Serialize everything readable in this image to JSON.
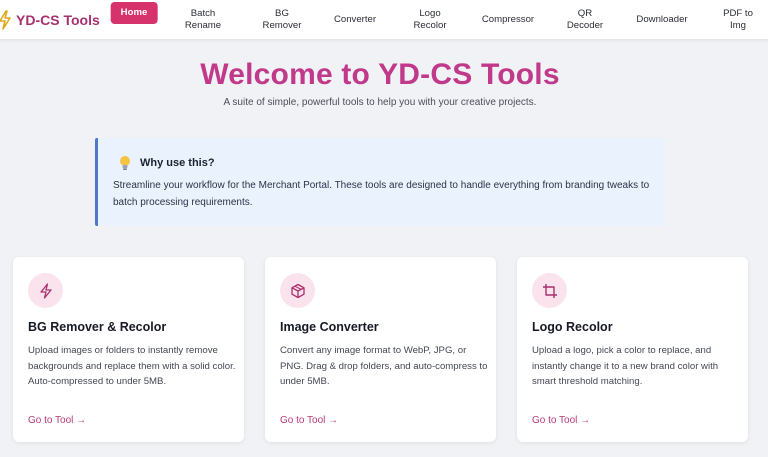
{
  "brand": {
    "name": "YD-CS Tools",
    "icon": "lightning-bolt-icon"
  },
  "nav": {
    "items": [
      {
        "label": "Home",
        "active": true
      },
      {
        "label": "Batch\nRename",
        "active": false
      },
      {
        "label": "BG\nRemover",
        "active": false
      },
      {
        "label": "Converter",
        "active": false
      },
      {
        "label": "Logo\nRecolor",
        "active": false
      },
      {
        "label": "Compressor",
        "active": false
      },
      {
        "label": "QR\nDecoder",
        "active": false
      },
      {
        "label": "Downloader",
        "active": false
      },
      {
        "label": "PDF to\nImg",
        "active": false
      }
    ]
  },
  "hero": {
    "title": "Welcome to YD-CS Tools",
    "subtitle": "A suite of simple, powerful tools to help you with your creative projects."
  },
  "info": {
    "icon": "lightbulb-icon",
    "title": "Why use this?",
    "text": "Streamline your workflow for the Merchant Portal. These tools are designed to handle everything from branding tweaks to batch processing requirements."
  },
  "cards": [
    {
      "icon": "lightning-icon",
      "title": "BG Remover & Recolor",
      "description": "Upload images or folders to instantly remove backgrounds and replace them with a solid color. Auto-compressed to under 5MB.",
      "link": "Go to Tool →"
    },
    {
      "icon": "cube-icon",
      "title": "Image Converter",
      "description": "Convert any image format to WebP, JPG, or PNG. Drag & drop folders, and auto-compress to under 5MB.",
      "link": "Go to Tool →"
    },
    {
      "icon": "crop-icon",
      "title": "Logo Recolor",
      "description": "Upload a logo, pick a color to replace, and instantly change it to a new brand color with smart threshold matching.",
      "link": "Go to Tool →"
    }
  ],
  "colors": {
    "accent": "#d6336c",
    "brand": "#a8306f",
    "hero_title": "#c0398a",
    "info_border": "#4e79c8",
    "info_bg": "#eaf2fd",
    "icon_bg": "#fbe3ee"
  }
}
